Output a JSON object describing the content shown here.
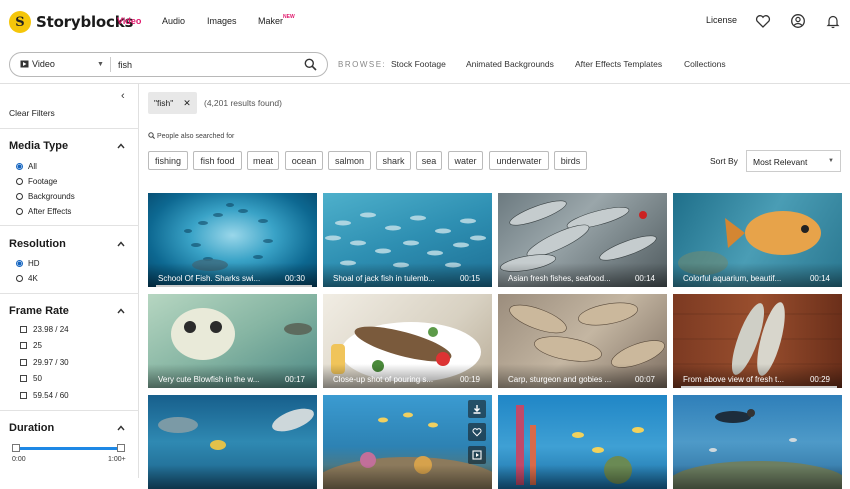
{
  "brand": {
    "name": "Storyblocks",
    "logo_letter": "S",
    "accent": "#e0186c",
    "logo_color": "#f5c60a"
  },
  "nav": {
    "video": "Video",
    "audio": "Audio",
    "images": "Images",
    "maker": "Maker",
    "maker_badge": "NEW"
  },
  "top_right": {
    "license": "License",
    "icons": [
      "heart-icon",
      "account-icon",
      "bell-icon"
    ]
  },
  "search": {
    "type_label": "Video",
    "query": "fish",
    "icon": "search-icon"
  },
  "browse": {
    "label": "BROWSE:",
    "links": [
      "Stock Footage",
      "Animated Backgrounds",
      "After Effects Templates",
      "Collections"
    ]
  },
  "sidebar": {
    "clear": "Clear Filters",
    "media_type": {
      "title": "Media Type",
      "options": [
        "All",
        "Footage",
        "Backgrounds",
        "After Effects"
      ],
      "selected": "All"
    },
    "resolution": {
      "title": "Resolution",
      "options": [
        "HD",
        "4K"
      ],
      "selected": "HD"
    },
    "frame_rate": {
      "title": "Frame Rate",
      "options": [
        "23.98 / 24",
        "25",
        "29.97 / 30",
        "50",
        "59.54 / 60"
      ]
    },
    "duration": {
      "title": "Duration",
      "min": "0:00",
      "max": "1:00+"
    }
  },
  "main": {
    "active_filter": "\"fish\"",
    "results": "(4,201 results found)",
    "also_searched": "People also searched for",
    "tags": [
      "fishing",
      "fish food",
      "meat",
      "ocean",
      "salmon",
      "shark",
      "sea",
      "water",
      "underwater",
      "birds"
    ],
    "sort_label": "Sort By",
    "sort_value": "Most Relevant"
  },
  "videos": [
    {
      "title": "School Of Fish. Sharks swi...",
      "duration": "00:30"
    },
    {
      "title": "Shoal of jack fish in tulemb...",
      "duration": "00:15"
    },
    {
      "title": "Asian fresh fishes, seafood...",
      "duration": "00:14"
    },
    {
      "title": "Colorful aquarium, beautif...",
      "duration": "00:14"
    },
    {
      "title": "Very cute Blowfish in the w...",
      "duration": "00:17"
    },
    {
      "title": "Close-up shot of pouring s...",
      "duration": "00:19"
    },
    {
      "title": "Carp, sturgeon and gobies ...",
      "duration": "00:07"
    },
    {
      "title": "From above view of fresh t...",
      "duration": "00:29"
    },
    {
      "title": "",
      "duration": ""
    },
    {
      "title": "",
      "duration": ""
    },
    {
      "title": "",
      "duration": ""
    },
    {
      "title": "",
      "duration": ""
    }
  ]
}
